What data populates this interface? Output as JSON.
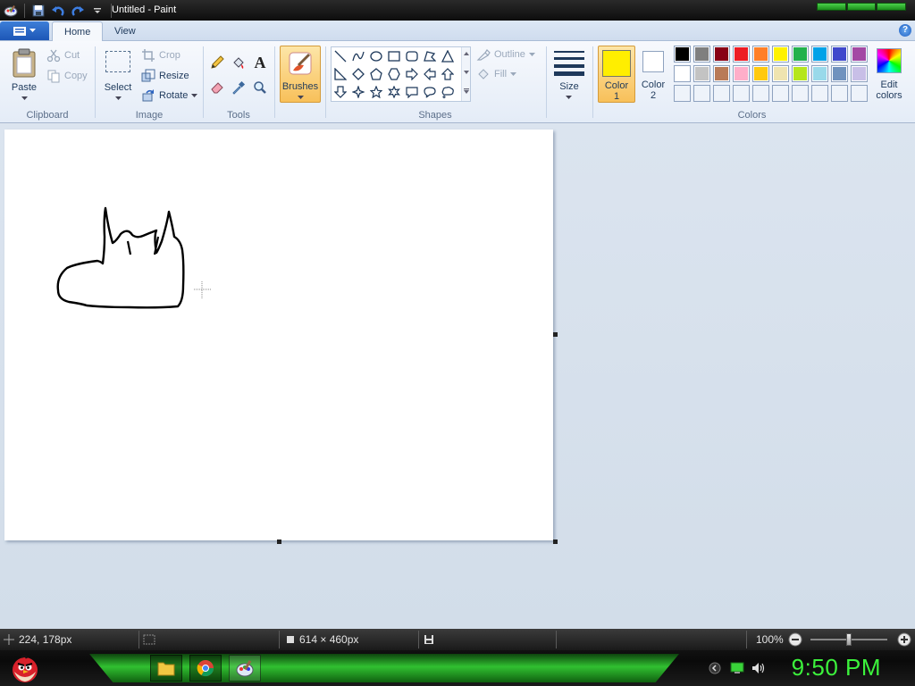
{
  "window": {
    "title": "Untitled - Paint"
  },
  "tabs": {
    "home": "Home",
    "view": "View",
    "help": "?"
  },
  "clipboard": {
    "paste": "Paste",
    "cut": "Cut",
    "copy": "Copy",
    "group": "Clipboard"
  },
  "image": {
    "select": "Select",
    "crop": "Crop",
    "resize": "Resize",
    "rotate": "Rotate",
    "group": "Image"
  },
  "tools": {
    "group": "Tools",
    "text_glyph": "A"
  },
  "brushes": {
    "label": "Brushes"
  },
  "shapes": {
    "outline": "Outline",
    "fill": "Fill",
    "group": "Shapes"
  },
  "size": {
    "label": "Size"
  },
  "colors": {
    "color1_label": "Color",
    "color1_num": "1",
    "color2_label": "Color",
    "color2_num": "2",
    "edit_label": "Edit",
    "edit_label2": "colors",
    "group": "Colors",
    "color1": "#ffee00",
    "color2": "#ffffff",
    "row1": [
      "#000000",
      "#7f7f7f",
      "#880015",
      "#ed1c24",
      "#ff7f27",
      "#fff200",
      "#22b14c",
      "#00a2e8",
      "#3f48cc",
      "#a349a4"
    ],
    "row2": [
      "#ffffff",
      "#c3c3c3",
      "#b97a57",
      "#ffaec9",
      "#ffc90e",
      "#efe4b0",
      "#b5e61d",
      "#99d9ea",
      "#7092be",
      "#c8bfe7"
    ],
    "row3": [
      "#ffffff",
      "#ffffff",
      "#ffffff",
      "#ffffff",
      "#ffffff",
      "#ffffff",
      "#ffffff",
      "#ffffff",
      "#ffffff",
      "#ffffff"
    ]
  },
  "status": {
    "cursor_pos": "224, 178px",
    "canvas_size": "614 × 460px",
    "zoom": "100%"
  },
  "taskbar": {
    "clock": "9:50 PM"
  }
}
